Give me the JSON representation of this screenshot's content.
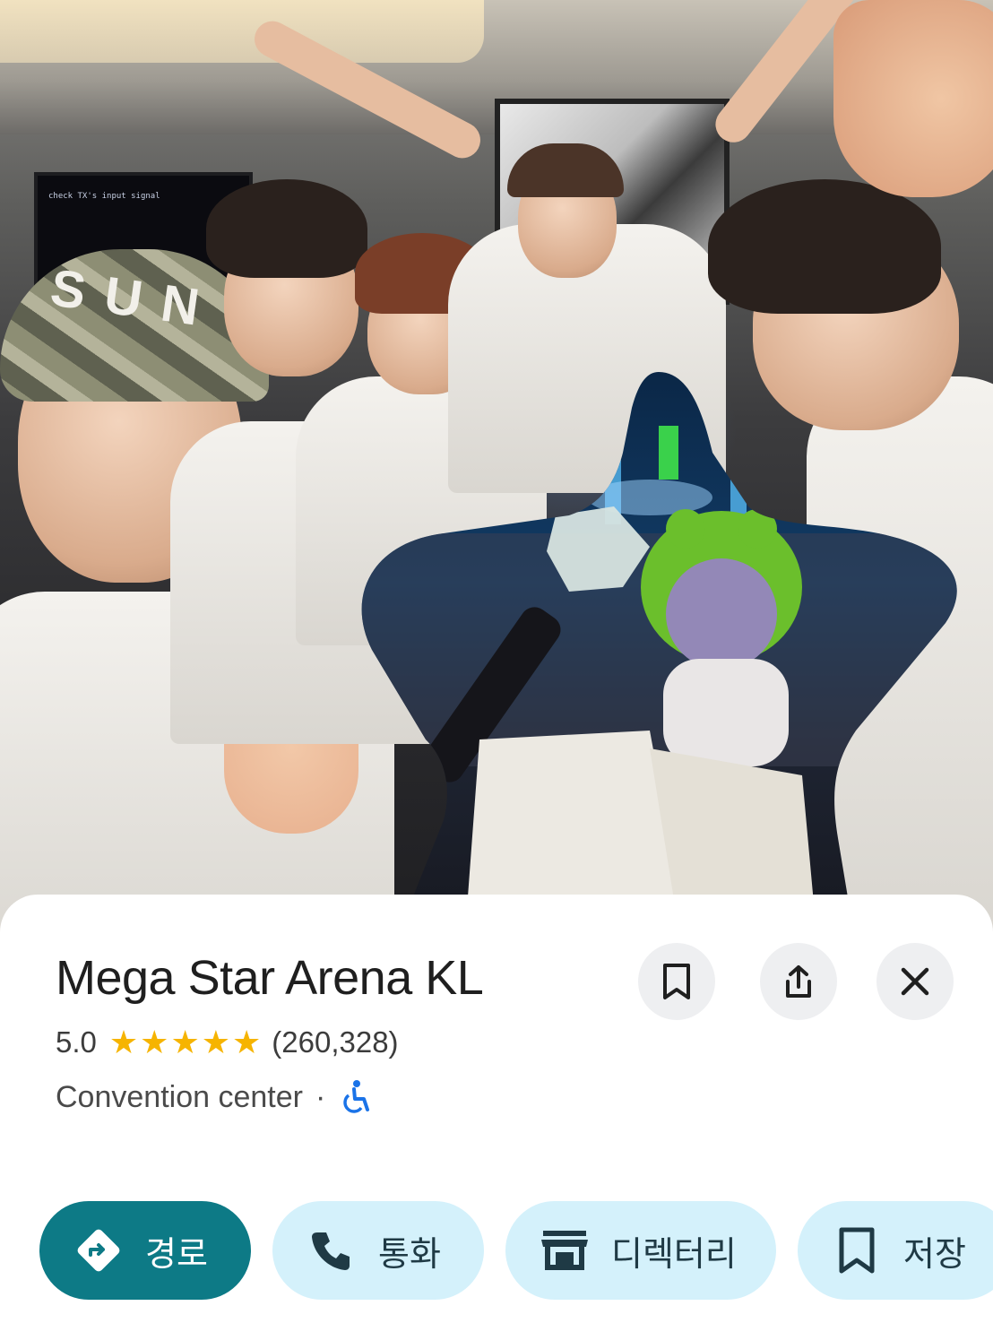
{
  "photo": {
    "monitor_text": "check TX's input signal"
  },
  "place": {
    "title": "Mega Star Arena KL",
    "rating": "5.0",
    "review_count": "(260,328)",
    "category": "Convention center",
    "separator": "·",
    "accessibility_icon": "wheelchair-accessible-icon"
  },
  "header_buttons": {
    "save_icon": "bookmark-icon",
    "share_icon": "share-icon",
    "close_icon": "close-icon"
  },
  "actions": [
    {
      "label": "경로",
      "icon": "directions-icon"
    },
    {
      "label": "통화",
      "icon": "phone-icon"
    },
    {
      "label": "디렉터리",
      "icon": "storefront-icon"
    },
    {
      "label": "저장",
      "icon": "bookmark-icon"
    }
  ],
  "colors": {
    "primary": "#0d7a86",
    "pill_bg": "#d4f1fb",
    "star": "#f6b400",
    "accessibility": "#1a73e8"
  }
}
